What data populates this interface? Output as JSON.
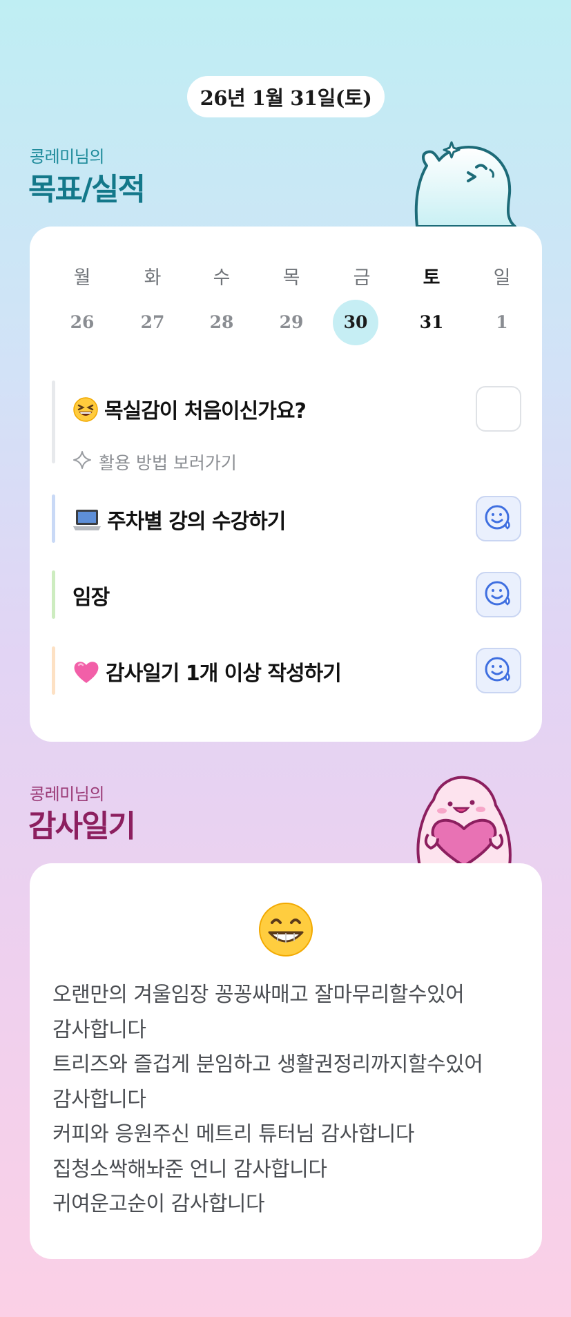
{
  "header": {
    "date": "26년 1월 31일(토)"
  },
  "goals_section": {
    "owner_label": "콩레미님의",
    "title": "목표/실적",
    "week": {
      "days": [
        {
          "name": "월",
          "num": "26"
        },
        {
          "name": "화",
          "num": "27"
        },
        {
          "name": "수",
          "num": "28"
        },
        {
          "name": "목",
          "num": "29"
        },
        {
          "name": "금",
          "num": "30"
        },
        {
          "name": "토",
          "num": "31"
        },
        {
          "name": "일",
          "num": "1"
        }
      ],
      "today_index": 4,
      "selected_index": 5
    },
    "goals": [
      {
        "icon": "grinning-squint-emoji-icon",
        "label": "목실감이 처음이신가요?",
        "sub": "활용 방법 보러가기",
        "sub_icon": "sparkle-icon",
        "status": "unchecked",
        "bar_color": "#e7e9ec"
      },
      {
        "icon": "laptop-emoji-icon",
        "label": "주차별 강의 수강하기",
        "status": "sweat-smile",
        "bar_color": "#c9d9f6"
      },
      {
        "icon": "",
        "label": "임장",
        "status": "sweat-smile",
        "bar_color": "#cdecc0"
      },
      {
        "icon": "pink-heart-emoji-icon",
        "label": "감사일기 1개 이상 작성하기",
        "status": "sweat-smile",
        "bar_color": "#fde1c4"
      }
    ]
  },
  "gratitude_section": {
    "owner_label": "콩레미님의",
    "title": "감사일기",
    "mood_icon": "big-grin-emoji-icon",
    "lines": [
      "오랜만의 겨울임장 꽁꽁싸매고 잘마무리할수있어",
      "감사합니다",
      "트리즈와 즐겁게 분임하고 생활권정리까지할수있어",
      "감사합니다",
      "커피와 응원주신 메트리 튜터님 감사합니다",
      "집청소싹해놔준 언니 감사합니다",
      "귀여운고순이 감사합니다"
    ]
  },
  "colors": {
    "accent_teal": "#13788a",
    "accent_magenta": "#8c1f5f",
    "today_circle": "#c6eef4",
    "status_button_bg": "#eaf0fd",
    "status_icon": "#3f6fe0"
  }
}
